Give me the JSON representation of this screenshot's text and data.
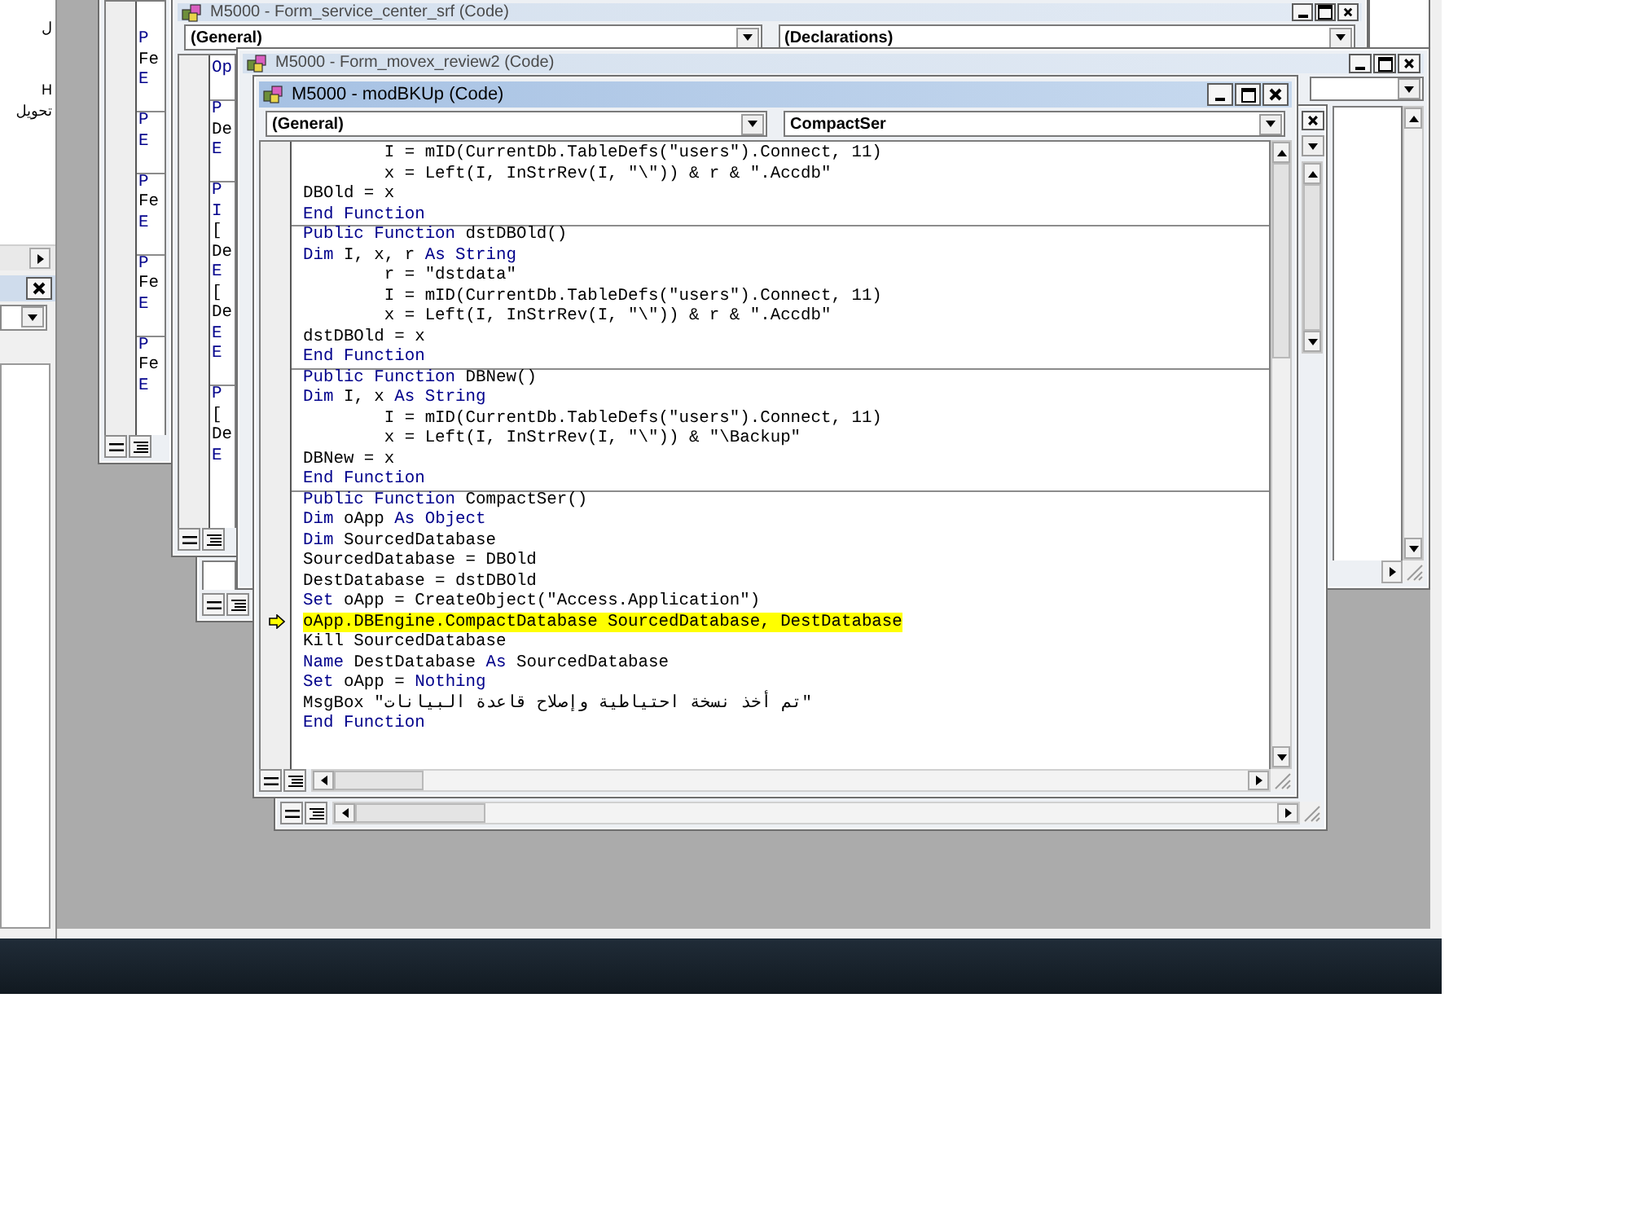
{
  "project_explorer": {
    "items": [
      {
        "text": "ل"
      },
      {
        "text": "H"
      },
      {
        "text": "تحويل"
      }
    ]
  },
  "background_windows": [
    {
      "procedures": [
        {
          "lines": [
            {
              "text": "P",
              "kind": "keyword"
            },
            {
              "text": "Fe",
              "kind": "plain"
            },
            {
              "text": "E",
              "kind": "keyword"
            }
          ]
        },
        {
          "lines": [
            {
              "text": "P",
              "kind": "keyword"
            },
            {
              "text": "E",
              "kind": "keyword"
            }
          ]
        },
        {
          "lines": [
            {
              "text": "P",
              "kind": "keyword"
            },
            {
              "text": "Fe",
              "kind": "plain"
            },
            {
              "text": "E",
              "kind": "keyword"
            }
          ]
        },
        {
          "lines": [
            {
              "text": "P",
              "kind": "keyword"
            },
            {
              "text": "Fe",
              "kind": "plain"
            },
            {
              "text": "E",
              "kind": "keyword"
            }
          ]
        },
        {
          "lines": [
            {
              "text": "P",
              "kind": "keyword"
            },
            {
              "text": "Fe",
              "kind": "plain"
            },
            {
              "text": "E",
              "kind": "keyword"
            }
          ]
        }
      ]
    },
    {
      "title": "M5000 - Form_service_center_srf (Code)",
      "active": false,
      "object_box": "(General)",
      "procedure_box": "(Declarations)",
      "procedures": [
        {
          "lines": [
            {
              "text": "Op",
              "kind": "keyword"
            }
          ]
        },
        {
          "lines": [
            {
              "text": "P",
              "kind": "keyword"
            },
            {
              "text": "De",
              "kind": "plain"
            },
            {
              "text": "E",
              "kind": "keyword"
            }
          ]
        },
        {
          "lines": [
            {
              "text": "P",
              "kind": "keyword"
            },
            {
              "text": "I",
              "kind": "keyword"
            },
            {
              "text": "[",
              "kind": "plain"
            },
            {
              "text": "De",
              "kind": "plain"
            },
            {
              "text": "E",
              "kind": "keyword"
            },
            {
              "text": "[",
              "kind": "plain"
            },
            {
              "text": "De",
              "kind": "plain"
            },
            {
              "text": "E",
              "kind": "keyword"
            },
            {
              "text": "E",
              "kind": "keyword"
            }
          ]
        },
        {
          "lines": [
            {
              "text": "P",
              "kind": "keyword"
            },
            {
              "text": "[",
              "kind": "plain"
            },
            {
              "text": "De",
              "kind": "plain"
            },
            {
              "text": "E",
              "kind": "keyword"
            }
          ]
        }
      ]
    },
    {
      "title": "M5000 - Form_movex_review2 (Code)",
      "active": false
    }
  ],
  "code_window": {
    "title": "M5000 - modBKUp (Code)",
    "active": true,
    "object_box": "(General)",
    "procedure_box": "CompactSer",
    "procedures": [
      {
        "lines": [
          {
            "current": false,
            "segments": [
              {
                "kind": "plain",
                "text": "        I = mID(CurrentDb.TableDefs(\"users\").Connect, 11)"
              }
            ]
          },
          {
            "current": false,
            "segments": [
              {
                "kind": "plain",
                "text": "        x = Left(I, InStrRev(I, \"\\\")) & r & \".Accdb\""
              }
            ]
          },
          {
            "current": false,
            "segments": [
              {
                "kind": "plain",
                "text": "DBOld = x"
              }
            ]
          },
          {
            "current": false,
            "segments": [
              {
                "kind": "keyword",
                "text": "End Function"
              }
            ]
          }
        ]
      },
      {
        "lines": [
          {
            "current": false,
            "segments": [
              {
                "kind": "keyword",
                "text": "Public Function "
              },
              {
                "kind": "plain",
                "text": "dstDBOld()"
              }
            ]
          },
          {
            "current": false,
            "segments": [
              {
                "kind": "keyword",
                "text": "Dim"
              },
              {
                "kind": "plain",
                "text": " I, x, r "
              },
              {
                "kind": "keyword",
                "text": "As String"
              }
            ]
          },
          {
            "current": false,
            "segments": [
              {
                "kind": "plain",
                "text": "        r = \"dstdata\""
              }
            ]
          },
          {
            "current": false,
            "segments": [
              {
                "kind": "plain",
                "text": "        I = mID(CurrentDb.TableDefs(\"users\").Connect, 11)"
              }
            ]
          },
          {
            "current": false,
            "segments": [
              {
                "kind": "plain",
                "text": "        x = Left(I, InStrRev(I, \"\\\")) & r & \".Accdb\""
              }
            ]
          },
          {
            "current": false,
            "segments": [
              {
                "kind": "plain",
                "text": "dstDBOld = x"
              }
            ]
          },
          {
            "current": false,
            "segments": [
              {
                "kind": "keyword",
                "text": "End Function"
              }
            ]
          }
        ]
      },
      {
        "lines": [
          {
            "current": false,
            "segments": [
              {
                "kind": "keyword",
                "text": "Public Function "
              },
              {
                "kind": "plain",
                "text": "DBNew()"
              }
            ]
          },
          {
            "current": false,
            "segments": [
              {
                "kind": "keyword",
                "text": "Dim"
              },
              {
                "kind": "plain",
                "text": " I, x "
              },
              {
                "kind": "keyword",
                "text": "As String"
              }
            ]
          },
          {
            "current": false,
            "segments": [
              {
                "kind": "plain",
                "text": "        I = mID(CurrentDb.TableDefs(\"users\").Connect, 11)"
              }
            ]
          },
          {
            "current": false,
            "segments": [
              {
                "kind": "plain",
                "text": "        x = Left(I, InStrRev(I, \"\\\")) & \"\\Backup\""
              }
            ]
          },
          {
            "current": false,
            "segments": [
              {
                "kind": "plain",
                "text": "DBNew = x"
              }
            ]
          },
          {
            "current": false,
            "segments": [
              {
                "kind": "keyword",
                "text": "End Function"
              }
            ]
          }
        ]
      },
      {
        "lines": [
          {
            "current": false,
            "segments": [
              {
                "kind": "keyword",
                "text": "Public Function "
              },
              {
                "kind": "plain",
                "text": "CompactSer()"
              }
            ]
          },
          {
            "current": false,
            "segments": [
              {
                "kind": "keyword",
                "text": "Dim"
              },
              {
                "kind": "plain",
                "text": " oApp "
              },
              {
                "kind": "keyword",
                "text": "As Object"
              }
            ]
          },
          {
            "current": false,
            "segments": [
              {
                "kind": "keyword",
                "text": "Dim"
              },
              {
                "kind": "plain",
                "text": " SourcedDatabase"
              }
            ]
          },
          {
            "current": false,
            "segments": [
              {
                "kind": "plain",
                "text": "SourcedDatabase = DBOld"
              }
            ]
          },
          {
            "current": false,
            "segments": [
              {
                "kind": "plain",
                "text": "DestDatabase = dstDBOld"
              }
            ]
          },
          {
            "current": false,
            "segments": [
              {
                "kind": "keyword",
                "text": "Set"
              },
              {
                "kind": "plain",
                "text": " oApp = CreateObject(\"Access.Application\")"
              }
            ]
          },
          {
            "current": true,
            "segments": [
              {
                "kind": "plain",
                "text": "oApp.DBEngine.CompactDatabase SourcedDatabase, DestDatabase"
              }
            ]
          },
          {
            "current": false,
            "segments": [
              {
                "kind": "plain",
                "text": "Kill SourcedDatabase"
              }
            ]
          },
          {
            "current": false,
            "segments": [
              {
                "kind": "keyword",
                "text": "Name"
              },
              {
                "kind": "plain",
                "text": " DestDatabase "
              },
              {
                "kind": "keyword",
                "text": "As"
              },
              {
                "kind": "plain",
                "text": " SourcedDatabase"
              }
            ]
          },
          {
            "current": false,
            "segments": [
              {
                "kind": "keyword",
                "text": "Set"
              },
              {
                "kind": "plain",
                "text": " oApp = "
              },
              {
                "kind": "keyword",
                "text": "Nothing"
              }
            ]
          },
          {
            "current": false,
            "segments": [
              {
                "kind": "plain",
                "text": "MsgBox \"تم أخذ نسخة احتياطية وإصلاح قاعدة البيانات\""
              }
            ]
          },
          {
            "current": false,
            "segments": [
              {
                "kind": "keyword",
                "text": "End Function"
              }
            ]
          }
        ]
      }
    ]
  }
}
